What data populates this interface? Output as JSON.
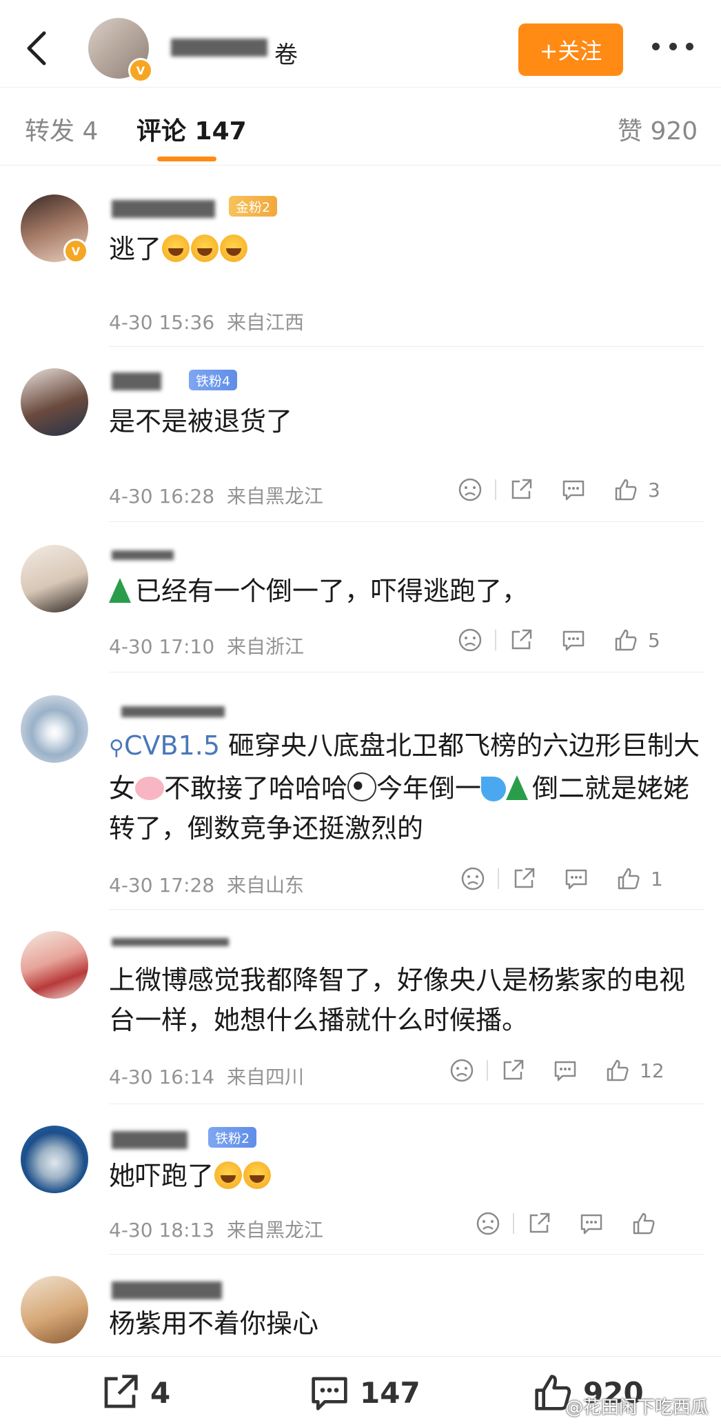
{
  "header": {
    "name_tail": "卷",
    "follow_label": "+关注"
  },
  "tabs": {
    "repost": "转发 4",
    "comments": "评论 147",
    "likes": "赞 920"
  },
  "comments": [
    {
      "badge": "金粉2",
      "badge_type": "gold",
      "text": "逃了",
      "emoji_after": 3,
      "time": "4-30 15:36",
      "location": "来自江西",
      "likes": ""
    },
    {
      "badge": "铁粉4",
      "badge_type": "iron",
      "text": "是不是被退货了",
      "time": "4-30 16:28",
      "location": "来自黑龙江",
      "likes": "3"
    },
    {
      "text": "已经有一个倒一了，吓得逃跑了，",
      "time": "4-30 17:10",
      "location": "来自浙江",
      "likes": "5"
    },
    {
      "tag": "CVB1.5",
      "text": " 砸穿央八底盘北卫都飞榜的六边形巨制大女",
      "text2": "不敢接了哈哈哈",
      "text3": "今年倒一",
      "text4": "倒二就是姥姥转了，倒数竞争还挺激烈的",
      "time": "4-30 17:28",
      "location": "来自山东",
      "likes": "1"
    },
    {
      "text": "上微博感觉我都降智了，好像央八是杨紫家的电视台一样，她想什么播就什么时候播。",
      "time": "4-30 16:14",
      "location": "来自四川",
      "likes": "12"
    },
    {
      "badge": "铁粉2",
      "badge_type": "iron",
      "text": "她吓跑了",
      "time": "4-30 18:13",
      "location": "来自黑龙江",
      "likes": ""
    },
    {
      "text": "杨紫用不着你操心"
    }
  ],
  "bottom": {
    "reposts": "4",
    "comments": "147",
    "likes": "920"
  },
  "watermark": "@花田闲下吃西瓜"
}
